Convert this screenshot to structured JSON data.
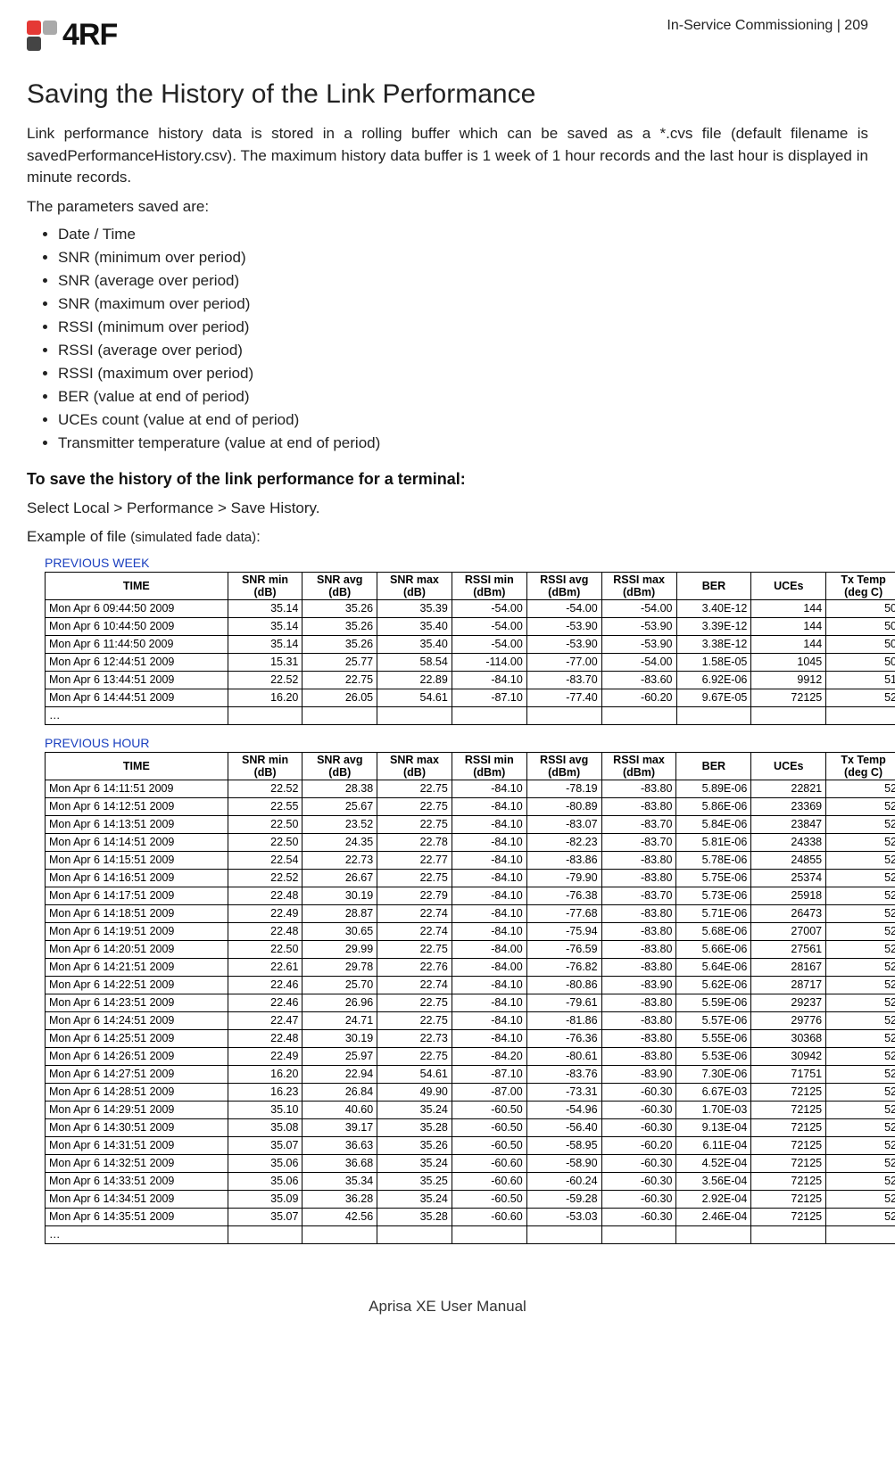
{
  "header": {
    "logo_text": "4RF",
    "right_text": "In-Service Commissioning  |  209"
  },
  "title": "Saving the History of the Link Performance",
  "para1": "Link performance history data is stored in a rolling buffer which can be saved as a *.cvs file (default filename is savedPerformanceHistory.csv). The maximum history data buffer is 1 week of 1 hour records and the last hour is displayed in minute records.",
  "params_intro": "The parameters saved are:",
  "params": [
    "Date / Time",
    "SNR (minimum over period)",
    "SNR (average over period)",
    "SNR (maximum over period)",
    "RSSI (minimum over period)",
    "RSSI (average over period)",
    "RSSI (maximum over period)",
    "BER (value at end of period)",
    "UCEs count (value at end of period)",
    "Transmitter temperature (value at end of period)"
  ],
  "save_heading": "To save the history of the link performance for a terminal:",
  "nav_path": "Select Local > Performance > Save History.",
  "example_label": "Example of file ",
  "example_note": "(simulated fade data)",
  "example_colon": ":",
  "section_week": "PREVIOUS WEEK",
  "section_hour": "PREVIOUS HOUR",
  "columns": [
    "TIME",
    "SNR min (dB)",
    "SNR avg (dB)",
    "SNR max (dB)",
    "RSSI min (dBm)",
    "RSSI avg (dBm)",
    "RSSI max (dBm)",
    "BER",
    "UCEs",
    "Tx Temp (deg C)"
  ],
  "week_rows": [
    [
      "Mon Apr  6 09:44:50 2009",
      "35.14",
      "35.26",
      "35.39",
      "-54.00",
      "-54.00",
      "-54.00",
      "3.40E-12",
      "144",
      "50"
    ],
    [
      "Mon Apr  6 10:44:50 2009",
      "35.14",
      "35.26",
      "35.40",
      "-54.00",
      "-53.90",
      "-53.90",
      "3.39E-12",
      "144",
      "50"
    ],
    [
      "Mon Apr  6 11:44:50 2009",
      "35.14",
      "35.26",
      "35.40",
      "-54.00",
      "-53.90",
      "-53.90",
      "3.38E-12",
      "144",
      "50"
    ],
    [
      "Mon Apr  6 12:44:51 2009",
      "15.31",
      "25.77",
      "58.54",
      "-114.00",
      "-77.00",
      "-54.00",
      "1.58E-05",
      "1045",
      "50"
    ],
    [
      "Mon Apr  6 13:44:51 2009",
      "22.52",
      "22.75",
      "22.89",
      "-84.10",
      "-83.70",
      "-83.60",
      "6.92E-06",
      "9912",
      "51"
    ],
    [
      "Mon Apr  6 14:44:51 2009",
      "16.20",
      "26.05",
      "54.61",
      "-87.10",
      "-77.40",
      "-60.20",
      "9.67E-05",
      "72125",
      "52"
    ],
    [
      "…",
      "",
      "",
      "",
      "",
      "",
      "",
      "",
      "",
      ""
    ]
  ],
  "hour_rows": [
    [
      "Mon Apr  6 14:11:51 2009",
      "22.52",
      "28.38",
      "22.75",
      "-84.10",
      "-78.19",
      "-83.80",
      "5.89E-06",
      "22821",
      "52"
    ],
    [
      "Mon Apr  6 14:12:51 2009",
      "22.55",
      "25.67",
      "22.75",
      "-84.10",
      "-80.89",
      "-83.80",
      "5.86E-06",
      "23369",
      "52"
    ],
    [
      "Mon Apr  6 14:13:51 2009",
      "22.50",
      "23.52",
      "22.75",
      "-84.10",
      "-83.07",
      "-83.70",
      "5.84E-06",
      "23847",
      "52"
    ],
    [
      "Mon Apr  6 14:14:51 2009",
      "22.50",
      "24.35",
      "22.78",
      "-84.10",
      "-82.23",
      "-83.70",
      "5.81E-06",
      "24338",
      "52"
    ],
    [
      "Mon Apr  6 14:15:51 2009",
      "22.54",
      "22.73",
      "22.77",
      "-84.10",
      "-83.86",
      "-83.80",
      "5.78E-06",
      "24855",
      "52"
    ],
    [
      "Mon Apr  6 14:16:51 2009",
      "22.52",
      "26.67",
      "22.75",
      "-84.10",
      "-79.90",
      "-83.80",
      "5.75E-06",
      "25374",
      "52"
    ],
    [
      "Mon Apr  6 14:17:51 2009",
      "22.48",
      "30.19",
      "22.79",
      "-84.10",
      "-76.38",
      "-83.70",
      "5.73E-06",
      "25918",
      "52"
    ],
    [
      "Mon Apr  6 14:18:51 2009",
      "22.49",
      "28.87",
      "22.74",
      "-84.10",
      "-77.68",
      "-83.80",
      "5.71E-06",
      "26473",
      "52"
    ],
    [
      "Mon Apr  6 14:19:51 2009",
      "22.48",
      "30.65",
      "22.74",
      "-84.10",
      "-75.94",
      "-83.80",
      "5.68E-06",
      "27007",
      "52"
    ],
    [
      "Mon Apr  6 14:20:51 2009",
      "22.50",
      "29.99",
      "22.75",
      "-84.00",
      "-76.59",
      "-83.80",
      "5.66E-06",
      "27561",
      "52"
    ],
    [
      "Mon Apr  6 14:21:51 2009",
      "22.61",
      "29.78",
      "22.76",
      "-84.00",
      "-76.82",
      "-83.80",
      "5.64E-06",
      "28167",
      "52"
    ],
    [
      "Mon Apr  6 14:22:51 2009",
      "22.46",
      "25.70",
      "22.74",
      "-84.10",
      "-80.86",
      "-83.90",
      "5.62E-06",
      "28717",
      "52"
    ],
    [
      "Mon Apr  6 14:23:51 2009",
      "22.46",
      "26.96",
      "22.75",
      "-84.10",
      "-79.61",
      "-83.80",
      "5.59E-06",
      "29237",
      "52"
    ],
    [
      "Mon Apr  6 14:24:51 2009",
      "22.47",
      "24.71",
      "22.75",
      "-84.10",
      "-81.86",
      "-83.80",
      "5.57E-06",
      "29776",
      "52"
    ],
    [
      "Mon Apr  6 14:25:51 2009",
      "22.48",
      "30.19",
      "22.73",
      "-84.10",
      "-76.36",
      "-83.80",
      "5.55E-06",
      "30368",
      "52"
    ],
    [
      "Mon Apr  6 14:26:51 2009",
      "22.49",
      "25.97",
      "22.75",
      "-84.20",
      "-80.61",
      "-83.80",
      "5.53E-06",
      "30942",
      "52"
    ],
    [
      "Mon Apr  6 14:27:51 2009",
      "16.20",
      "22.94",
      "54.61",
      "-87.10",
      "-83.76",
      "-83.90",
      "7.30E-06",
      "71751",
      "52"
    ],
    [
      "Mon Apr  6 14:28:51 2009",
      "16.23",
      "26.84",
      "49.90",
      "-87.00",
      "-73.31",
      "-60.30",
      "6.67E-03",
      "72125",
      "52"
    ],
    [
      "Mon Apr  6 14:29:51 2009",
      "35.10",
      "40.60",
      "35.24",
      "-60.50",
      "-54.96",
      "-60.30",
      "1.70E-03",
      "72125",
      "52"
    ],
    [
      "Mon Apr  6 14:30:51 2009",
      "35.08",
      "39.17",
      "35.28",
      "-60.50",
      "-56.40",
      "-60.30",
      "9.13E-04",
      "72125",
      "52"
    ],
    [
      "Mon Apr  6 14:31:51 2009",
      "35.07",
      "36.63",
      "35.26",
      "-60.50",
      "-58.95",
      "-60.20",
      "6.11E-04",
      "72125",
      "52"
    ],
    [
      "Mon Apr  6 14:32:51 2009",
      "35.06",
      "36.68",
      "35.24",
      "-60.60",
      "-58.90",
      "-60.30",
      "4.52E-04",
      "72125",
      "52"
    ],
    [
      "Mon Apr  6 14:33:51 2009",
      "35.06",
      "35.34",
      "35.25",
      "-60.60",
      "-60.24",
      "-60.30",
      "3.56E-04",
      "72125",
      "52"
    ],
    [
      "Mon Apr  6 14:34:51 2009",
      "35.09",
      "36.28",
      "35.24",
      "-60.50",
      "-59.28",
      "-60.30",
      "2.92E-04",
      "72125",
      "52"
    ],
    [
      "Mon Apr  6 14:35:51 2009",
      "35.07",
      "42.56",
      "35.28",
      "-60.60",
      "-53.03",
      "-60.30",
      "2.46E-04",
      "72125",
      "52"
    ],
    [
      "…",
      "",
      "",
      "",
      "",
      "",
      "",
      "",
      "",
      ""
    ]
  ],
  "footer": "Aprisa XE User Manual"
}
